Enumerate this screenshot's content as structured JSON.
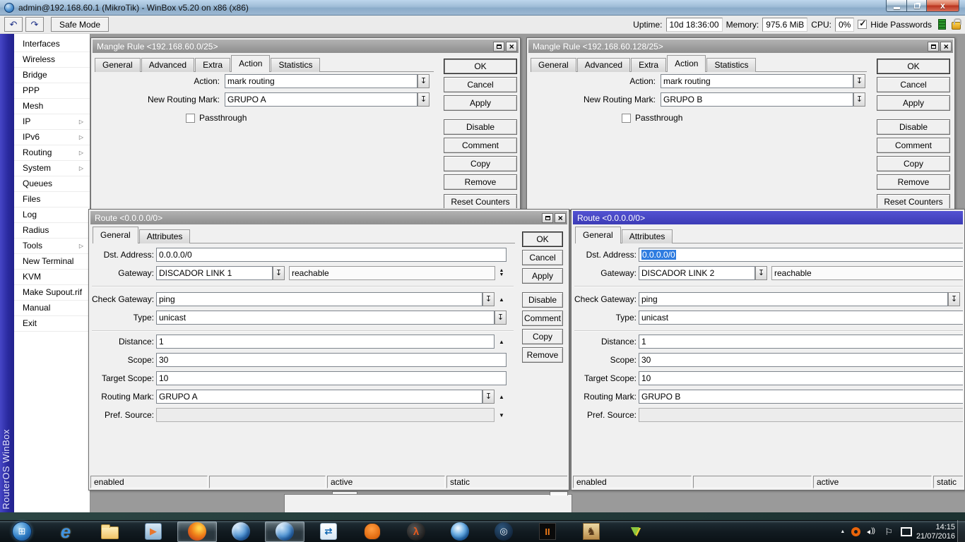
{
  "app": {
    "title": "admin@192.168.60.1 (MikroTik) - WinBox v5.20 on x86 (x86)"
  },
  "toolbar": {
    "undo_icon": "↶",
    "redo_icon": "↷",
    "safe_mode": "Safe Mode",
    "uptime_label": "Uptime:",
    "uptime_value": "10d 18:36:00",
    "memory_label": "Memory:",
    "memory_value": "975.6 MiB",
    "cpu_label": "CPU:",
    "cpu_value": "0%",
    "hide_passwords_label": "Hide Passwords"
  },
  "brand_vertical": "RouterOS WinBox",
  "sidebar": {
    "items": [
      {
        "label": "Interfaces"
      },
      {
        "label": "Wireless"
      },
      {
        "label": "Bridge"
      },
      {
        "label": "PPP"
      },
      {
        "label": "Mesh"
      },
      {
        "label": "IP",
        "submenu": true
      },
      {
        "label": "IPv6",
        "submenu": true
      },
      {
        "label": "Routing",
        "submenu": true
      },
      {
        "label": "System",
        "submenu": true
      },
      {
        "label": "Queues"
      },
      {
        "label": "Files"
      },
      {
        "label": "Log"
      },
      {
        "label": "Radius"
      },
      {
        "label": "Tools",
        "submenu": true
      },
      {
        "label": "New Terminal"
      },
      {
        "label": "KVM"
      },
      {
        "label": "Make Supout.rif"
      },
      {
        "label": "Manual"
      },
      {
        "label": "Exit"
      }
    ]
  },
  "dialogs": {
    "mangle_a": {
      "title": "Mangle Rule <192.168.60.0/25>",
      "tabs": [
        {
          "label": "General"
        },
        {
          "label": "Advanced"
        },
        {
          "label": "Extra"
        },
        {
          "label": "Action",
          "selected": true
        },
        {
          "label": "Statistics"
        }
      ],
      "action_label": "Action:",
      "action_value": "mark routing",
      "routing_mark_label": "New Routing Mark:",
      "routing_mark_value": "GRUPO A",
      "passthrough_label": "Passthrough",
      "buttons": [
        {
          "label": "OK",
          "cls": "default"
        },
        {
          "label": "Cancel"
        },
        {
          "label": "Apply"
        },
        {
          "label": "Disable",
          "cls": "gap"
        },
        {
          "label": "Comment"
        },
        {
          "label": "Copy"
        },
        {
          "label": "Remove"
        },
        {
          "label": "Reset Counters",
          "cls": "gap2"
        }
      ]
    },
    "mangle_b": {
      "title": "Mangle Rule <192.168.60.128/25>",
      "tabs": [
        {
          "label": "General"
        },
        {
          "label": "Advanced"
        },
        {
          "label": "Extra"
        },
        {
          "label": "Action",
          "selected": true
        },
        {
          "label": "Statistics"
        }
      ],
      "action_label": "Action:",
      "action_value": "mark routing",
      "routing_mark_label": "New Routing Mark:",
      "routing_mark_value": "GRUPO B",
      "passthrough_label": "Passthrough",
      "buttons": [
        {
          "label": "OK",
          "cls": "default"
        },
        {
          "label": "Cancel"
        },
        {
          "label": "Apply"
        },
        {
          "label": "Disable",
          "cls": "gap"
        },
        {
          "label": "Comment"
        },
        {
          "label": "Copy"
        },
        {
          "label": "Remove"
        },
        {
          "label": "Reset Counters",
          "cls": "gap2"
        }
      ]
    },
    "route_a": {
      "title": "Route <0.0.0.0/0>",
      "tabs": [
        {
          "label": "General",
          "selected": true
        },
        {
          "label": "Attributes"
        }
      ],
      "dst_label": "Dst. Address:",
      "dst_value": "0.0.0.0/0",
      "gateway_label": "Gateway:",
      "gateway_value": "DISCADOR LINK 1",
      "gateway_status": "reachable",
      "check_gateway_label": "Check Gateway:",
      "check_gateway_value": "ping",
      "type_label": "Type:",
      "type_value": "unicast",
      "distance_label": "Distance:",
      "distance_value": "1",
      "scope_label": "Scope:",
      "scope_value": "30",
      "target_scope_label": "Target Scope:",
      "target_scope_value": "10",
      "routing_mark_label": "Routing Mark:",
      "routing_mark_value": "GRUPO A",
      "pref_source_label": "Pref. Source:",
      "pref_source_value": "",
      "buttons": [
        {
          "label": "OK",
          "cls": "default"
        },
        {
          "label": "Cancel"
        },
        {
          "label": "Apply"
        },
        {
          "label": "Disable",
          "cls": "gap"
        },
        {
          "label": "Comment"
        },
        {
          "label": "Copy"
        },
        {
          "label": "Remove"
        }
      ],
      "status": [
        "enabled",
        "",
        "active",
        "static"
      ]
    },
    "route_b": {
      "title": "Route <0.0.0.0/0>",
      "tabs": [
        {
          "label": "General",
          "selected": true
        },
        {
          "label": "Attributes"
        }
      ],
      "dst_label": "Dst. Address:",
      "dst_value": "0.0.0.0/0",
      "gateway_label": "Gateway:",
      "gateway_value": "DISCADOR LINK 2",
      "gateway_status": "reachable",
      "check_gateway_label": "Check Gateway:",
      "check_gateway_value": "ping",
      "type_label": "Type:",
      "type_value": "unicast",
      "distance_label": "Distance:",
      "distance_value": "1",
      "scope_label": "Scope:",
      "scope_value": "30",
      "target_scope_label": "Target Scope:",
      "target_scope_value": "10",
      "routing_mark_label": "Routing Mark:",
      "routing_mark_value": "GRUPO B",
      "pref_source_label": "Pref. Source:",
      "pref_source_value": "",
      "status": [
        "enabled",
        "",
        "active",
        "static"
      ]
    }
  },
  "taskbar": {
    "icons": [
      {
        "name": "start-button",
        "cls": "ic-start",
        "glyph": "⊞"
      },
      {
        "name": "internet-explorer-icon",
        "cls": "ic-ie",
        "glyph": "e"
      },
      {
        "name": "windows-explorer-icon",
        "cls": "ic-folder",
        "glyph": ""
      },
      {
        "name": "media-player-icon",
        "cls": "ic-wmp",
        "glyph": "▶"
      },
      {
        "name": "firefox-icon",
        "cls": "ic-firefox",
        "glyph": "",
        "pressed": true
      },
      {
        "name": "winbox-icon",
        "cls": "ic-winbox",
        "glyph": ""
      },
      {
        "name": "winbox-active-icon",
        "cls": "ic-winbox",
        "glyph": "",
        "pressed": true
      },
      {
        "name": "teamviewer-icon",
        "cls": "ic-tv",
        "glyph": "⇄"
      },
      {
        "name": "hand-app-icon",
        "cls": "ic-hand",
        "glyph": ""
      },
      {
        "name": "halflife-icon",
        "cls": "ic-hl",
        "glyph": "λ"
      },
      {
        "name": "google-earth-icon",
        "cls": "ic-earth",
        "glyph": ""
      },
      {
        "name": "steam-icon",
        "cls": "ic-steam",
        "glyph": "◎"
      },
      {
        "name": "black-ops-2-icon",
        "cls": "ic-bo2",
        "glyph": "II"
      },
      {
        "name": "game-icon",
        "cls": "ic-cc",
        "glyph": "♞"
      },
      {
        "name": "vuze-icon",
        "cls": "ic-vuze",
        "glyph": "▼"
      }
    ]
  },
  "tray": {
    "icons": [
      {
        "name": "hidden-icons-chevron",
        "cls": "tr-chev",
        "glyph": "▲"
      },
      {
        "name": "avira-tray-icon",
        "cls": "tr-avira",
        "glyph": ""
      },
      {
        "name": "volume-icon",
        "cls": "tr-vol",
        "glyph": ""
      },
      {
        "name": "action-center-flag-icon",
        "cls": "tr-flag",
        "glyph": "⚐"
      },
      {
        "name": "network-icon",
        "cls": "tr-net",
        "glyph": ""
      }
    ],
    "time": "14:15",
    "date": "21/07/2016"
  }
}
